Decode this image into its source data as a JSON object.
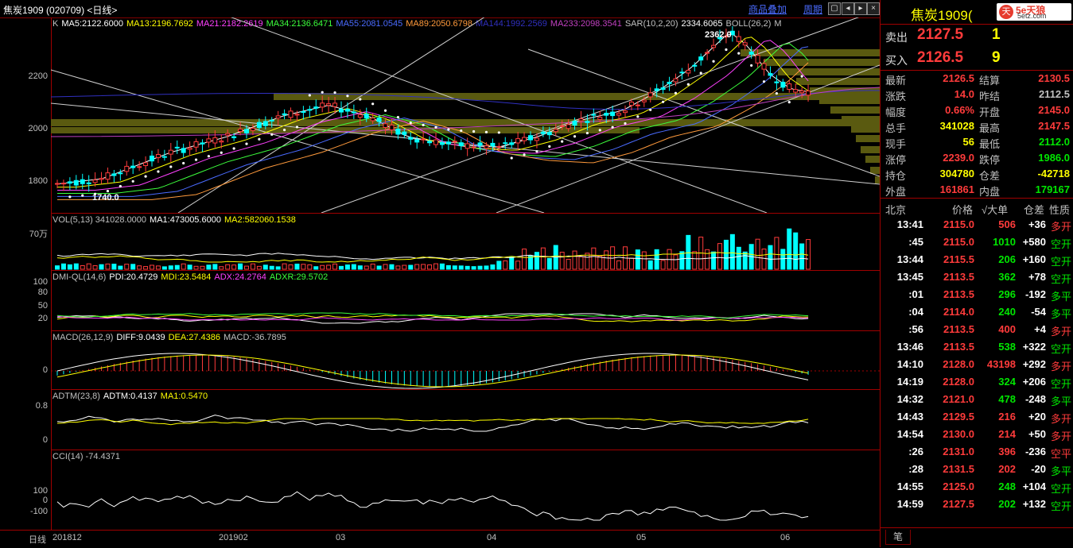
{
  "header": {
    "title": "焦炭1909 (020709) <日线>",
    "overlay_label": "商品叠加",
    "period_label": "周期"
  },
  "main_chart": {
    "ma_legend": [
      {
        "text": "K",
        "color": "#c0c0c0"
      },
      {
        "text": "MA5:2122.6000",
        "color": "#ffffff"
      },
      {
        "text": "MA13:2196.7692",
        "color": "#ffff00"
      },
      {
        "text": "MA21:2182.2619",
        "color": "#ff40ff"
      },
      {
        "text": "MA34:2136.6471",
        "color": "#3cff3c"
      },
      {
        "text": "MA55:2081.0545",
        "color": "#4a6bff"
      },
      {
        "text": "MA89:2050.6798",
        "color": "#ff9a3c"
      },
      {
        "text": "MA144:1992.2569",
        "color": "#3030c0"
      },
      {
        "text": "MA233:2098.3541",
        "color": "#c040c0"
      },
      {
        "text": "SAR(10,2,20)",
        "color": "#c0c0c0"
      },
      {
        "text": "2334.6065",
        "color": "#ffffff"
      },
      {
        "text": "BOLL(26,2)",
        "color": "#c0c0c0"
      },
      {
        "text": "M",
        "color": "#c0c0c0"
      }
    ],
    "y_labels": [
      "2200",
      "2000",
      "1800"
    ],
    "high_label": "2362.0",
    "low_label": "1740.0"
  },
  "vol_chart": {
    "legend": [
      {
        "text": "VOL(5,13) 341028.0000",
        "color": "#c0c0c0"
      },
      {
        "text": "MA1:473005.6000",
        "color": "#ffffff"
      },
      {
        "text": "MA2:582060.1538",
        "color": "#ffff00"
      }
    ],
    "y_label": "70万"
  },
  "dmi_chart": {
    "legend": [
      {
        "text": "DMI-QL(14,6)",
        "color": "#c0c0c0"
      },
      {
        "text": "PDI:20.4729",
        "color": "#ffffff"
      },
      {
        "text": "MDI:23.5484",
        "color": "#ffff00"
      },
      {
        "text": "ADX:24.2764",
        "color": "#ff40ff"
      },
      {
        "text": "ADXR:29.5702",
        "color": "#3cff3c"
      }
    ],
    "y_labels": [
      "100",
      "80",
      "50",
      "20"
    ]
  },
  "macd_chart": {
    "legend": [
      {
        "text": "MACD(26,12,9)",
        "color": "#c0c0c0"
      },
      {
        "text": "DIFF:9.0439",
        "color": "#ffffff"
      },
      {
        "text": "DEA:27.4386",
        "color": "#ffff00"
      },
      {
        "text": "MACD:-36.7895",
        "color": "#c0c0c0"
      }
    ],
    "y_labels": [
      "0"
    ]
  },
  "adtm_chart": {
    "legend": [
      {
        "text": "ADTM(23,8)",
        "color": "#c0c0c0"
      },
      {
        "text": "ADTM:0.4137",
        "color": "#ffffff"
      },
      {
        "text": "MA1:0.5470",
        "color": "#ffff00"
      }
    ],
    "y_labels": [
      "0.8",
      "0"
    ]
  },
  "cci_chart": {
    "legend": [
      {
        "text": "CCI(14) -74.4371",
        "color": "#c0c0c0"
      }
    ],
    "y_labels": [
      "100",
      "0",
      "-100"
    ]
  },
  "x_axis": {
    "period": "日线",
    "labels": [
      "201812",
      "201902",
      "03",
      "04",
      "05",
      "06"
    ]
  },
  "quote": {
    "name": "焦炭1909(",
    "sell_label": "卖出",
    "sell_price": "2127.5",
    "sell_qty": "1",
    "buy_label": "买入",
    "buy_price": "2126.5",
    "buy_qty": "9",
    "stats": [
      {
        "l1": "最新",
        "v1": "2126.5",
        "c1": "#ff3b3b",
        "l2": "结算",
        "v2": "2130.5",
        "c2": "#ff3b3b"
      },
      {
        "l1": "涨跌",
        "v1": "14.0",
        "c1": "#ff3b3b",
        "l2": "昨结",
        "v2": "2112.5",
        "c2": "#c0c0c0"
      },
      {
        "l1": "幅度",
        "v1": "0.66%",
        "c1": "#ff3b3b",
        "l2": "开盘",
        "v2": "2145.0",
        "c2": "#ff3b3b"
      },
      {
        "l1": "总手",
        "v1": "341028",
        "c1": "#ffff00",
        "l2": "最高",
        "v2": "2147.5",
        "c2": "#ff3b3b"
      },
      {
        "l1": "现手",
        "v1": "56",
        "c1": "#ffff00",
        "l2": "最低",
        "v2": "2112.0",
        "c2": "#00e600"
      },
      {
        "l1": "涨停",
        "v1": "2239.0",
        "c1": "#ff3b3b",
        "l2": "跌停",
        "v2": "1986.0",
        "c2": "#00e600"
      },
      {
        "l1": "持仓",
        "v1": "304780",
        "c1": "#ffff00",
        "l2": "仓差",
        "v2": "-42718",
        "c2": "#ffff00"
      },
      {
        "l1": "外盘",
        "v1": "161861",
        "c1": "#ff3b3b",
        "l2": "内盘",
        "v2": "179167",
        "c2": "#00e600"
      }
    ]
  },
  "ticks": {
    "headers": [
      "北京",
      "价格",
      "√大单",
      "仓差",
      "性质"
    ],
    "rows": [
      {
        "time": "13:41",
        "price": "2115.0",
        "vol": "506",
        "vc": "#ff3b3b",
        "diff": "+36",
        "nature": "多开",
        "nc": "#ff3b3b"
      },
      {
        "time": ":45",
        "price": "2115.0",
        "vol": "1010",
        "vc": "#00e600",
        "diff": "+580",
        "nature": "空开",
        "nc": "#00e600"
      },
      {
        "time": "13:44",
        "price": "2115.5",
        "vol": "206",
        "vc": "#00e600",
        "diff": "+160",
        "nature": "空开",
        "nc": "#00e600"
      },
      {
        "time": "13:45",
        "price": "2113.5",
        "vol": "362",
        "vc": "#00e600",
        "diff": "+78",
        "nature": "空开",
        "nc": "#00e600"
      },
      {
        "time": ":01",
        "price": "2113.5",
        "vol": "296",
        "vc": "#00e600",
        "diff": "-192",
        "nature": "多平",
        "nc": "#00e600"
      },
      {
        "time": ":04",
        "price": "2114.0",
        "vol": "240",
        "vc": "#00e600",
        "diff": "-54",
        "nature": "多平",
        "nc": "#00e600"
      },
      {
        "time": ":56",
        "price": "2113.5",
        "vol": "400",
        "vc": "#ff3b3b",
        "diff": "+4",
        "nature": "多开",
        "nc": "#ff3b3b"
      },
      {
        "time": "13:46",
        "price": "2113.5",
        "vol": "538",
        "vc": "#00e600",
        "diff": "+322",
        "nature": "空开",
        "nc": "#00e600"
      },
      {
        "time": "14:10",
        "price": "2128.0",
        "vol": "43198",
        "vc": "#ff3b3b",
        "diff": "+292",
        "nature": "多开",
        "nc": "#ff3b3b"
      },
      {
        "time": "14:19",
        "price": "2128.0",
        "vol": "324",
        "vc": "#00e600",
        "diff": "+206",
        "nature": "空开",
        "nc": "#00e600"
      },
      {
        "time": "14:32",
        "price": "2121.0",
        "vol": "478",
        "vc": "#00e600",
        "diff": "-248",
        "nature": "多平",
        "nc": "#00e600"
      },
      {
        "time": "14:43",
        "price": "2129.5",
        "vol": "216",
        "vc": "#ff3b3b",
        "diff": "+20",
        "nature": "多开",
        "nc": "#ff3b3b"
      },
      {
        "time": "14:54",
        "price": "2130.0",
        "vol": "214",
        "vc": "#ff3b3b",
        "diff": "+50",
        "nature": "多开",
        "nc": "#ff3b3b"
      },
      {
        "time": ":26",
        "price": "2131.0",
        "vol": "396",
        "vc": "#ff3b3b",
        "diff": "-236",
        "nature": "空平",
        "nc": "#ff3b3b"
      },
      {
        "time": ":28",
        "price": "2131.5",
        "vol": "202",
        "vc": "#ff3b3b",
        "diff": "-20",
        "nature": "多平",
        "nc": "#00e600"
      },
      {
        "time": "14:55",
        "price": "2125.0",
        "vol": "248",
        "vc": "#00e600",
        "diff": "+104",
        "nature": "空开",
        "nc": "#00e600"
      },
      {
        "time": "14:59",
        "price": "2127.5",
        "vol": "202",
        "vc": "#00e600",
        "diff": "+132",
        "nature": "空开",
        "nc": "#00e600"
      }
    ],
    "footer_tab": "笔"
  },
  "logo": {
    "text": "5e天狼",
    "sub": "5etz.com"
  }
}
